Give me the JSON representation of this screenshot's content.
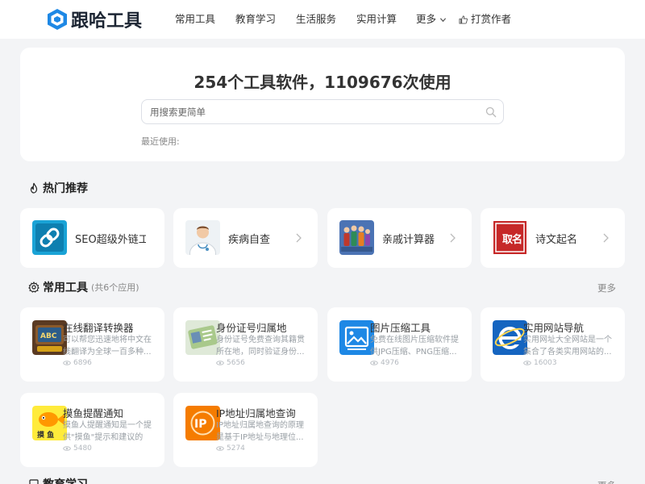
{
  "header": {
    "logo_text": "跟哈工具",
    "nav": [
      {
        "label": "常用工具"
      },
      {
        "label": "教育学习"
      },
      {
        "label": "生活服务"
      },
      {
        "label": "实用计算"
      },
      {
        "label": "更多"
      },
      {
        "label": "打赏作者"
      }
    ]
  },
  "hero": {
    "title": "254个工具软件，1109676次使用",
    "search_placeholder": "用搜索更简单",
    "recent_label": "最近使用:"
  },
  "hot": {
    "title": "热门推荐",
    "items": [
      {
        "label": "SEO超级外链工具",
        "icon": "chain-link-icon"
      },
      {
        "label": "疾病自查",
        "icon": "doctor-icon"
      },
      {
        "label": "亲戚计算器",
        "icon": "family-icon"
      },
      {
        "label": "诗文起名",
        "icon": "seal-name-icon"
      }
    ]
  },
  "common": {
    "title": "常用工具",
    "count": "(共6个应用)",
    "more": "更多",
    "items": [
      {
        "title": "在线翻译转换器",
        "desc": "可以帮您迅速地将中文在线翻译为全球一百多种...",
        "views": "6896",
        "icon": "translate-icon"
      },
      {
        "title": "身份证号归属地",
        "desc": "身份证号免费查询其籍贯所在地，同时验证身份...",
        "views": "5656",
        "icon": "id-card-icon"
      },
      {
        "title": "图片压缩工具",
        "desc": "免费在线图片压缩软件提供JPG压缩、PNG压缩...",
        "views": "4976",
        "icon": "image-icon"
      },
      {
        "title": "实用网站导航",
        "desc": "实用网址大全网站是一个集合了各类实用网站的...",
        "views": "16003",
        "icon": "browser-e-icon"
      },
      {
        "title": "摸鱼提醒通知",
        "desc": "摸鱼人提醒通知是一个提供\"摸鱼\"提示和建议的网...",
        "views": "5480",
        "icon": "fish-icon"
      },
      {
        "title": "IP地址归属地查询",
        "desc": "IP地址归属地查询的原理是基于IP地址与地理位...",
        "views": "5274",
        "icon": "ip-icon"
      }
    ]
  },
  "education": {
    "title": "教育学习",
    "more": "更多"
  },
  "colors": {
    "accent": "#1e88e5",
    "background": "#f3f4f6"
  }
}
